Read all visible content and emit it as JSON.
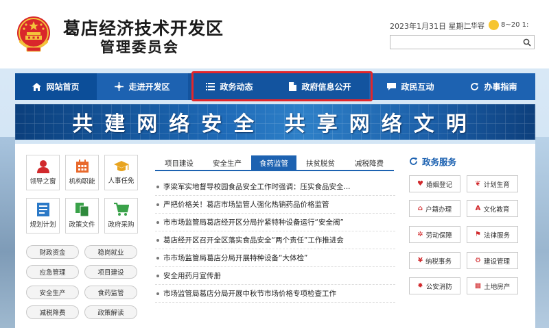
{
  "header": {
    "title_line1": "葛店经济技术开发区",
    "title_line2": "管理委员会",
    "date": "2023年1月31日 星期二",
    "separator": "|",
    "weather_place": "华容",
    "weather_temp": "8~20 1:",
    "search": {
      "placeholder": "",
      "icon": "search-icon"
    }
  },
  "nav": {
    "items": [
      {
        "label": "网站首页",
        "icon": "home-icon"
      },
      {
        "label": "走进开发区",
        "icon": "compass-icon"
      },
      {
        "label": "政务动态",
        "icon": "list-icon"
      },
      {
        "label": "政府信息公开",
        "icon": "document-icon"
      },
      {
        "label": "政民互动",
        "icon": "chat-icon"
      },
      {
        "label": "办事指南",
        "icon": "refresh-icon"
      }
    ]
  },
  "banner": {
    "text": "共建网络安全 共享网络文明"
  },
  "quick_links": [
    {
      "label": "领导之窗",
      "icon": "person-icon",
      "color": "#d1292c"
    },
    {
      "label": "机构职能",
      "icon": "calendar-icon",
      "color": "#e8692c"
    },
    {
      "label": "人事任免",
      "icon": "graduation-cap-icon",
      "color": "#e8a420"
    },
    {
      "label": "规划计划",
      "icon": "plan-icon",
      "color": "#2b79c7"
    },
    {
      "label": "政策文件",
      "icon": "files-icon",
      "color": "#3aa24a"
    },
    {
      "label": "政府采购",
      "icon": "cart-icon",
      "color": "#3aa24a"
    }
  ],
  "topic_pills": [
    "财政资金",
    "稳岗就业",
    "应急管理",
    "项目建设",
    "安全生产",
    "食药监管",
    "减税降费",
    "政策解读"
  ],
  "tabs": [
    "项目建设",
    "安全生产",
    "食药监管",
    "扶贫脱贫",
    "减税降费"
  ],
  "active_tab": "食药监管",
  "news": [
    "李梁军实地督导校园食品安全工作时强调：压实食品安全...",
    "严把价格关！葛店市场监管人强化热销药品价格监管",
    "市市场监管局葛店经开区分局拧紧特种设备运行“安全阀”",
    "葛店经开区召开全区落实食品安全“两个责任”工作推进会",
    "市市场监管局葛店分局开展特种设备“大体检”",
    "安全用药月宣传册",
    "市场监管局葛店分局开展中秋节市场价格专项检查工作"
  ],
  "services": {
    "title": "政务服务",
    "items": [
      {
        "label": "婚姻登记",
        "icon": "heart-icon",
        "glyph": "♥"
      },
      {
        "label": "计划生育",
        "icon": "leaf-icon",
        "glyph": "❦"
      },
      {
        "label": "户籍办理",
        "icon": "house-icon",
        "glyph": "⌂"
      },
      {
        "label": "文化教育",
        "icon": "letter-a-icon",
        "glyph": "A"
      },
      {
        "label": "劳动保障",
        "icon": "gear-icon",
        "glyph": "✲"
      },
      {
        "label": "法律服务",
        "icon": "flag-icon",
        "glyph": "⚑"
      },
      {
        "label": "纳税事务",
        "icon": "yen-icon",
        "glyph": "¥"
      },
      {
        "label": "建设管理",
        "icon": "settings-icon",
        "glyph": "⚙"
      },
      {
        "label": "公安消防",
        "icon": "fire-icon",
        "glyph": "✹"
      },
      {
        "label": "土地房产",
        "icon": "building-icon",
        "glyph": "▦"
      }
    ]
  },
  "colors": {
    "nav_blue": "#1d62b1",
    "highlight_red": "#e3262a",
    "accent_red": "#d1292c"
  }
}
